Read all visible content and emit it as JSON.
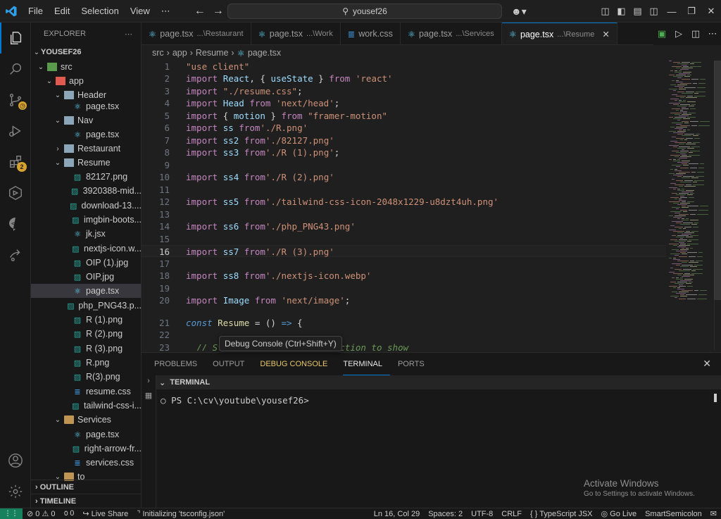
{
  "menu": [
    "File",
    "Edit",
    "Selection",
    "View",
    "⋯"
  ],
  "search": {
    "text": "yousef26"
  },
  "explorer": {
    "title": "EXPLORER",
    "root": "YOUSEF26",
    "items": [
      {
        "label": "src",
        "depth": 1,
        "type": "folder-green",
        "chev": "⌄"
      },
      {
        "label": "app",
        "depth": 2,
        "type": "folder-red",
        "chev": "⌄"
      },
      {
        "label": "Header",
        "depth": 3,
        "type": "folder-blue",
        "chev": "⌄"
      },
      {
        "label": "page.tsx",
        "depth": 4,
        "type": "react"
      },
      {
        "label": "Nav",
        "depth": 3,
        "type": "folder-blue",
        "chev": "⌄"
      },
      {
        "label": "page.tsx",
        "depth": 4,
        "type": "react"
      },
      {
        "label": "Restaurant",
        "depth": 3,
        "type": "folder-blue",
        "chev": "›"
      },
      {
        "label": "Resume",
        "depth": 3,
        "type": "folder-blue",
        "chev": "⌄"
      },
      {
        "label": "82127.png",
        "depth": 4,
        "type": "img"
      },
      {
        "label": "3920388-mid...",
        "depth": 4,
        "type": "img"
      },
      {
        "label": "download-13....",
        "depth": 4,
        "type": "img"
      },
      {
        "label": "imgbin-boots...",
        "depth": 4,
        "type": "img"
      },
      {
        "label": "jk.jsx",
        "depth": 4,
        "type": "react"
      },
      {
        "label": "nextjs-icon.w...",
        "depth": 4,
        "type": "img"
      },
      {
        "label": "OIP (1).jpg",
        "depth": 4,
        "type": "img"
      },
      {
        "label": "OIP.jpg",
        "depth": 4,
        "type": "img"
      },
      {
        "label": "page.tsx",
        "depth": 4,
        "type": "react",
        "selected": true
      },
      {
        "label": "php_PNG43.p...",
        "depth": 4,
        "type": "img"
      },
      {
        "label": "R (1).png",
        "depth": 4,
        "type": "img"
      },
      {
        "label": "R (2).png",
        "depth": 4,
        "type": "img"
      },
      {
        "label": "R (3).png",
        "depth": 4,
        "type": "img"
      },
      {
        "label": "R.png",
        "depth": 4,
        "type": "img"
      },
      {
        "label": "R(3).png",
        "depth": 4,
        "type": "img"
      },
      {
        "label": "resume.css",
        "depth": 4,
        "type": "css"
      },
      {
        "label": "tailwind-css-i...",
        "depth": 4,
        "type": "img"
      },
      {
        "label": "Services",
        "depth": 3,
        "type": "folder",
        "chev": "⌄"
      },
      {
        "label": "page.tsx",
        "depth": 4,
        "type": "react"
      },
      {
        "label": "right-arrow-fr...",
        "depth": 4,
        "type": "img"
      },
      {
        "label": "services.css",
        "depth": 4,
        "type": "css"
      },
      {
        "label": "to",
        "depth": 3,
        "type": "folder",
        "chev": "⌄"
      }
    ],
    "outline": "OUTLINE",
    "timeline": "TIMELINE"
  },
  "activity": {
    "extensions_badge": "2"
  },
  "tabs": [
    {
      "name": "page.tsx",
      "desc": "...\\Restaurant",
      "icon": "react"
    },
    {
      "name": "page.tsx",
      "desc": "...\\Work",
      "icon": "react"
    },
    {
      "name": "work.css",
      "desc": "",
      "icon": "css"
    },
    {
      "name": "page.tsx",
      "desc": "...\\Services",
      "icon": "react"
    },
    {
      "name": "page.tsx",
      "desc": "...\\Resume",
      "icon": "react",
      "active": true
    }
  ],
  "breadcrumb": [
    "src",
    "app",
    "Resume",
    "page.tsx"
  ],
  "code": [
    {
      "n": "1",
      "segs": [
        [
          "str",
          "\"use client\""
        ]
      ]
    },
    {
      "n": "2",
      "segs": [
        [
          "kw",
          "import "
        ],
        [
          "id",
          "React"
        ],
        [
          "plain",
          ", { "
        ],
        [
          "id",
          "useState"
        ],
        [
          "plain",
          " } "
        ],
        [
          "kw",
          "from "
        ],
        [
          "str",
          "'react'"
        ]
      ]
    },
    {
      "n": "3",
      "segs": [
        [
          "kw",
          "import "
        ],
        [
          "str",
          "\"./resume.css\""
        ],
        [
          "plain",
          ";"
        ]
      ]
    },
    {
      "n": "4",
      "segs": [
        [
          "kw",
          "import "
        ],
        [
          "id",
          "Head"
        ],
        [
          "kw",
          " from "
        ],
        [
          "str",
          "'next/head'"
        ],
        [
          "plain",
          ";"
        ]
      ]
    },
    {
      "n": "5",
      "segs": [
        [
          "kw",
          "import "
        ],
        [
          "plain",
          "{ "
        ],
        [
          "id",
          "motion"
        ],
        [
          "plain",
          " } "
        ],
        [
          "kw",
          "from "
        ],
        [
          "str",
          "\"framer-motion\""
        ]
      ]
    },
    {
      "n": "6",
      "segs": [
        [
          "kw",
          "import "
        ],
        [
          "id",
          "ss"
        ],
        [
          "kw",
          " from"
        ],
        [
          "str",
          "'./R.png'"
        ]
      ]
    },
    {
      "n": "7",
      "segs": [
        [
          "kw",
          "import "
        ],
        [
          "id",
          "ss2"
        ],
        [
          "kw",
          " from"
        ],
        [
          "str",
          "'./82127.png'"
        ]
      ]
    },
    {
      "n": "8",
      "segs": [
        [
          "kw",
          "import "
        ],
        [
          "id",
          "ss3"
        ],
        [
          "kw",
          " from"
        ],
        [
          "str",
          "'./R (1).png'"
        ],
        [
          "plain",
          ";"
        ]
      ]
    },
    {
      "n": "9",
      "segs": []
    },
    {
      "n": "10",
      "segs": [
        [
          "kw",
          "import "
        ],
        [
          "id",
          "ss4"
        ],
        [
          "kw",
          " from"
        ],
        [
          "str",
          "'./R (2).png'"
        ]
      ]
    },
    {
      "n": "11",
      "segs": []
    },
    {
      "n": "12",
      "segs": [
        [
          "kw",
          "import "
        ],
        [
          "id",
          "ss5"
        ],
        [
          "kw",
          " from"
        ],
        [
          "str",
          "'./tailwind-css-icon-2048x1229-u8dzt4uh.png'"
        ]
      ]
    },
    {
      "n": "13",
      "segs": []
    },
    {
      "n": "14",
      "segs": [
        [
          "kw",
          "import "
        ],
        [
          "id",
          "ss6"
        ],
        [
          "kw",
          " from"
        ],
        [
          "str",
          "'./php_PNG43.png'"
        ]
      ]
    },
    {
      "n": "15",
      "segs": []
    },
    {
      "n": "16",
      "segs": [
        [
          "kw",
          "import "
        ],
        [
          "id",
          "ss7"
        ],
        [
          "kw",
          " from"
        ],
        [
          "str",
          "'./R (3).png'"
        ]
      ],
      "current": true
    },
    {
      "n": "17",
      "segs": []
    },
    {
      "n": "18",
      "segs": [
        [
          "kw",
          "import "
        ],
        [
          "id",
          "ss8"
        ],
        [
          "kw",
          " from"
        ],
        [
          "str",
          "'./nextjs-icon.webp'"
        ]
      ]
    },
    {
      "n": "19",
      "segs": []
    },
    {
      "n": "20",
      "segs": [
        [
          "kw",
          "import "
        ],
        [
          "id",
          "Image"
        ],
        [
          "kw",
          " from "
        ],
        [
          "str",
          "'next/image'"
        ],
        [
          "plain",
          ";"
        ]
      ]
    },
    {
      "n": "21",
      "segs": [
        [
          "fn-const",
          "const "
        ],
        [
          "fn-name",
          "Resume"
        ],
        [
          "plain",
          " = () "
        ],
        [
          "fn-const",
          "=>"
        ],
        [
          "plain",
          " {"
        ]
      ]
    },
    {
      "n": "22",
      "segs": []
    },
    {
      "n": "23",
      "segs": [
        [
          "plain",
          "  "
        ],
        [
          "comment",
          "// St"
        ],
        [
          "plain",
          "                      "
        ],
        [
          "comment",
          "ction to show"
        ]
      ]
    }
  ],
  "tooltip": "Debug Console (Ctrl+Shift+Y)",
  "panel": {
    "tabs": [
      "PROBLEMS",
      "OUTPUT",
      "DEBUG CONSOLE",
      "TERMINAL",
      "PORTS"
    ],
    "active_tab": "TERMINAL",
    "highlight_tab": "DEBUG CONSOLE",
    "terminal_title": "TERMINAL",
    "prompt": "PS C:\\cv\\youtube\\yousef26>",
    "watermark_title": "Activate Windows",
    "watermark_sub": "Go to Settings to activate Windows."
  },
  "status": {
    "problems": "⊘ 0 ⚠ 0",
    "ports": "൦ 0",
    "live_share": "Live Share",
    "init": "Initializing 'tsconfig.json'",
    "position": "Ln 16, Col 29",
    "spaces": "Spaces: 2",
    "encoding": "UTF-8",
    "eol": "CRLF",
    "language": "TypeScript JSX",
    "golive": "Go Live",
    "smartsemi": "SmartSemicolon"
  }
}
